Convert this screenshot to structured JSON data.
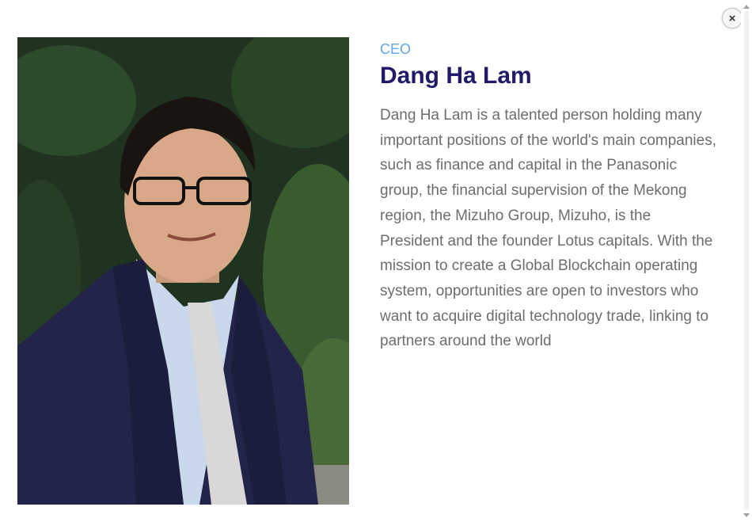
{
  "profile": {
    "role": "CEO",
    "name": "Dang Ha Lam",
    "bio": "Dang Ha Lam is a talented person holding many important positions of the world's main companies, such as finance and capital in the Panasonic group, the financial supervision of the Mekong region, the Mizuho Group, Mizuho, is the President and the founder Lotus capitals. With the mission to create a Global Blockchain operating system, opportunities are open to investors who want to acquire digital technology trade, linking to partners around the world",
    "photo_icon": "portrait-photo"
  },
  "close": {
    "glyph": "×",
    "icon": "close-icon"
  },
  "colors": {
    "role": "#5fa8e6",
    "name": "#22196b",
    "bio": "#6d6d6d"
  }
}
